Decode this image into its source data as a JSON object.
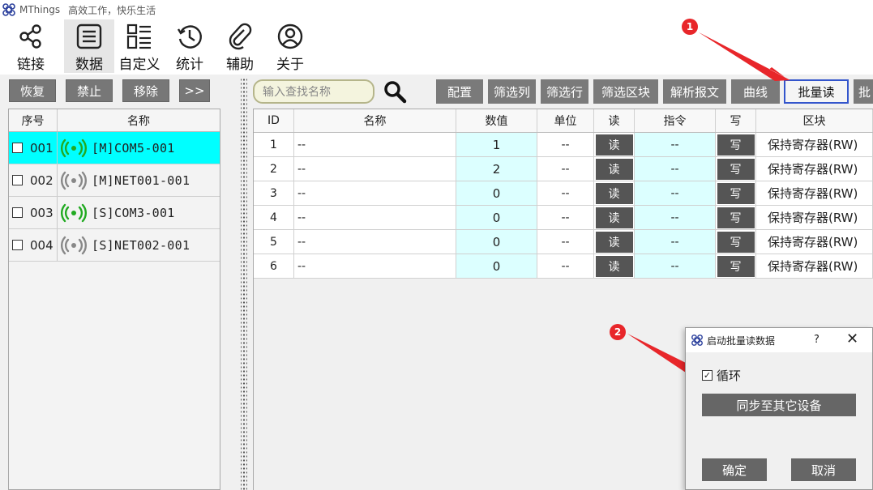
{
  "window": {
    "app_name": "MThings",
    "subtitle": "高效工作，快乐生活"
  },
  "main_tools": [
    {
      "label": "链接",
      "icon": "share-icon"
    },
    {
      "label": "数据",
      "icon": "list-icon"
    },
    {
      "label": "自定义",
      "icon": "custom-layout-icon"
    },
    {
      "label": "统计",
      "icon": "history-clock-icon"
    },
    {
      "label": "辅助",
      "icon": "paperclip-icon"
    },
    {
      "label": "关于",
      "icon": "user-icon"
    }
  ],
  "left_toolbar": {
    "restore": "恢复",
    "disable": "禁止",
    "remove": "移除",
    "expand": ">>"
  },
  "device_table": {
    "headers": {
      "index": "序号",
      "name": "名称"
    },
    "rows": [
      {
        "index": "001",
        "name": "[M]COM5-001",
        "signal_color": "#22aa22",
        "selected": true
      },
      {
        "index": "002",
        "name": "[M]NET001-001",
        "signal_color": "#888888",
        "selected": false
      },
      {
        "index": "003",
        "name": "[S]COM3-001",
        "signal_color": "#22aa22",
        "selected": false
      },
      {
        "index": "004",
        "name": "[S]NET002-001",
        "signal_color": "#888888",
        "selected": false
      }
    ]
  },
  "right_toolbar": {
    "search_placeholder": "输入查找名称",
    "config": "配置",
    "filter_columns": "筛选列",
    "filter_rows": "筛选行",
    "filter_blocks": "筛选区块",
    "parse_message": "解析报文",
    "curve": "曲线",
    "batch_read": "批量读",
    "batch_write_partial": "批"
  },
  "data_table": {
    "headers": {
      "id": "ID",
      "name": "名称",
      "value": "数值",
      "unit": "单位",
      "read": "读",
      "command": "指令",
      "write": "写",
      "area": "区块"
    },
    "rows": [
      {
        "id": "1",
        "name": "--",
        "value": "1",
        "unit": "--",
        "read": "读",
        "command": "--",
        "write": "写",
        "area": "保持寄存器(RW)"
      },
      {
        "id": "2",
        "name": "--",
        "value": "2",
        "unit": "--",
        "read": "读",
        "command": "--",
        "write": "写",
        "area": "保持寄存器(RW)"
      },
      {
        "id": "3",
        "name": "--",
        "value": "0",
        "unit": "--",
        "read": "读",
        "command": "--",
        "write": "写",
        "area": "保持寄存器(RW)"
      },
      {
        "id": "4",
        "name": "--",
        "value": "0",
        "unit": "--",
        "read": "读",
        "command": "--",
        "write": "写",
        "area": "保持寄存器(RW)"
      },
      {
        "id": "5",
        "name": "--",
        "value": "0",
        "unit": "--",
        "read": "读",
        "command": "--",
        "write": "写",
        "area": "保持寄存器(RW)"
      },
      {
        "id": "6",
        "name": "--",
        "value": "0",
        "unit": "--",
        "read": "读",
        "command": "--",
        "write": "写",
        "area": "保持寄存器(RW)"
      }
    ]
  },
  "markers": {
    "one": "1",
    "two": "2",
    "color": "#e8262a"
  },
  "dialog": {
    "title": "启动批量读数据",
    "help": "?",
    "close": "✕",
    "loop_label": "循环",
    "loop_checked": true,
    "sync_button": "同步至其它设备",
    "ok_button": "确定",
    "cancel_button": "取消"
  }
}
